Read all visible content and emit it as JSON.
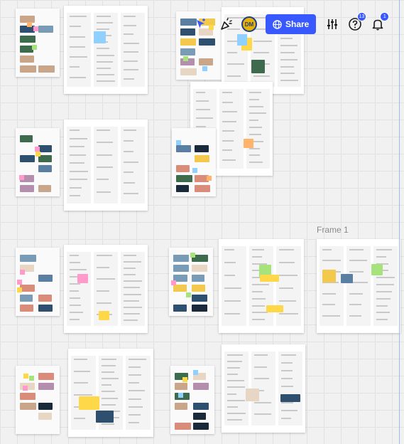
{
  "toolbar": {
    "share_label": "Share",
    "avatar_initials": "DM",
    "help_badge": "13",
    "notifications_badge": "1",
    "accent_color": "#3859ff",
    "icons": [
      "cursor-arrow-icon",
      "celebrate-icon",
      "globe-icon",
      "settings-sliders-icon",
      "help-icon",
      "bell-icon"
    ]
  },
  "board": {
    "frame_label": "Frame 1",
    "frames": [
      {
        "name": "frame-a1"
      },
      {
        "name": "frame-a2"
      },
      {
        "name": "frame-a3"
      },
      {
        "name": "frame-a4"
      },
      {
        "name": "frame-b1"
      },
      {
        "name": "frame-b2"
      },
      {
        "name": "frame-b3"
      },
      {
        "name": "frame-b4"
      },
      {
        "name": "frame-c1"
      },
      {
        "name": "frame-c2"
      },
      {
        "name": "frame-c3"
      },
      {
        "name": "frame-c4"
      },
      {
        "name": "frame-1"
      },
      {
        "name": "frame-d1"
      },
      {
        "name": "frame-d2"
      },
      {
        "name": "frame-d3"
      },
      {
        "name": "frame-d4"
      }
    ]
  }
}
